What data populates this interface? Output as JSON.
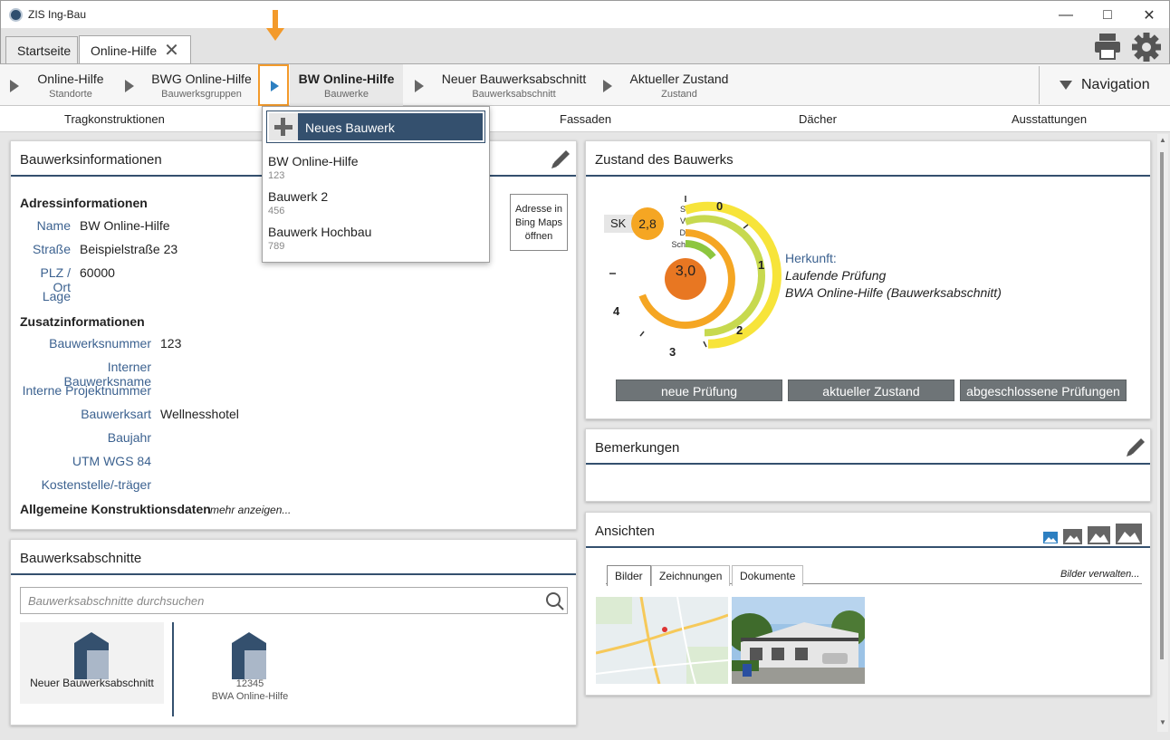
{
  "window": {
    "title": "ZIS Ing-Bau"
  },
  "tabs": [
    {
      "label": "Startseite"
    },
    {
      "label": "Online-Hilfe"
    }
  ],
  "breadcrumb": [
    {
      "title": "Online-Hilfe",
      "sub": "Standorte"
    },
    {
      "title": "BWG Online-Hilfe",
      "sub": "Bauwerksgruppen"
    },
    {
      "title": "BW Online-Hilfe",
      "sub": "Bauwerke"
    },
    {
      "title": "Neuer Bauwerksabschnitt",
      "sub": "Bauwerksabschnitt"
    },
    {
      "title": "Aktueller Zustand",
      "sub": "Zustand"
    }
  ],
  "navigation_label": "Navigation",
  "subnav": [
    "Tragkonstruktionen",
    "Fassaden",
    "Dächer",
    "Ausstattungen"
  ],
  "dropdown": {
    "new_label": "Neues Bauwerk",
    "items": [
      {
        "name": "BW Online-Hilfe",
        "number": "123"
      },
      {
        "name": "Bauwerk 2",
        "number": "456"
      },
      {
        "name": "Bauwerk Hochbau",
        "number": "789"
      }
    ]
  },
  "info": {
    "title": "Bauwerksinformationen",
    "address_heading": "Adressinformationen",
    "name_label": "Name",
    "name_value": "BW Online-Hilfe",
    "street_label": "Straße",
    "street_value": "Beispielstraße 23",
    "zip_label": "PLZ / Ort",
    "zip_value": "60000",
    "location_label": "Lage",
    "map_button": "Adresse in Bing Maps öffnen",
    "extra_heading": "Zusatzinformationen",
    "number_label": "Bauwerksnummer",
    "number_value": "123",
    "internal_name_label": "Interner Bauwerksname",
    "project_label": "Interne Projektnummer",
    "type_label": "Bauwerksart",
    "type_value": "Wellnesshotel",
    "year_label": "Baujahr",
    "utm_label": "UTM WGS 84",
    "cost_label": "Kostenstelle/-träger",
    "construction_heading": "Allgemeine Konstruktionsdaten",
    "more_link": "mehr anzeigen..."
  },
  "sections": {
    "title": "Bauwerksabschnitte",
    "search_placeholder": "Bauwerksabschnitte durchsuchen",
    "tiles": [
      {
        "label": "Neuer Bauwerksabschnitt"
      },
      {
        "number": "12345",
        "label": "BWA Online-Hilfe"
      }
    ]
  },
  "condition": {
    "title": "Zustand des Bauwerks",
    "sk_label": "SK",
    "sk_value": "2,8",
    "main_value": "3,0",
    "category_labels": [
      "S",
      "V",
      "D",
      "Sch"
    ],
    "scale_labels": [
      "0",
      "1",
      "2",
      "3",
      "4"
    ],
    "origin_label": "Herkunft:",
    "origin_line1": "Laufende Prüfung",
    "origin_line2": "BWA Online-Hilfe (Bauwerksabschnitt)",
    "buttons": [
      "neue Prüfung",
      "aktueller Zustand",
      "abgeschlossene Prüfungen"
    ],
    "colors": {
      "yellow": "#f7e43a",
      "lime": "#c7d94f",
      "orange": "#f5a623",
      "dark_orange": "#e87722"
    }
  },
  "remarks": {
    "title": "Bemerkungen"
  },
  "views": {
    "title": "Ansichten",
    "tabs": [
      "Bilder",
      "Zeichnungen",
      "Dokumente"
    ],
    "manage_link": "Bilder verwalten..."
  },
  "accent": {
    "navy": "#34506e",
    "orange": "#f39a2b",
    "link": "#3c6290"
  }
}
